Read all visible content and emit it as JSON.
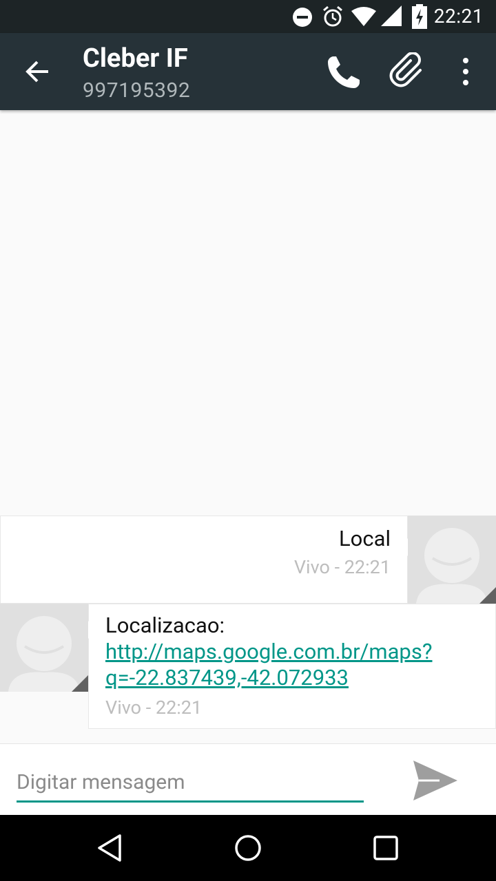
{
  "status_bar": {
    "time": "22:21",
    "icons": [
      "do-not-disturb-icon",
      "alarm-icon",
      "wifi-icon",
      "signal-icon",
      "battery-charging-icon"
    ]
  },
  "app_bar": {
    "contact_name": "Cleber IF",
    "contact_number": "997195392",
    "actions": [
      "call-icon",
      "attach-icon",
      "more-icon"
    ]
  },
  "messages": [
    {
      "direction": "outgoing",
      "text": "Local",
      "meta": "Vivo - 22:21"
    },
    {
      "direction": "incoming",
      "prefix": "Localizacao: ",
      "link_text": "http://maps.google.com.br/maps?q=-22.837439,-42.072933",
      "meta": "Vivo - 22:21"
    }
  ],
  "composer": {
    "placeholder": "Digitar mensagem"
  },
  "colors": {
    "status_bar": "#1d2426",
    "app_bar": "#263238",
    "accent": "#009688",
    "background": "#fafafa"
  }
}
